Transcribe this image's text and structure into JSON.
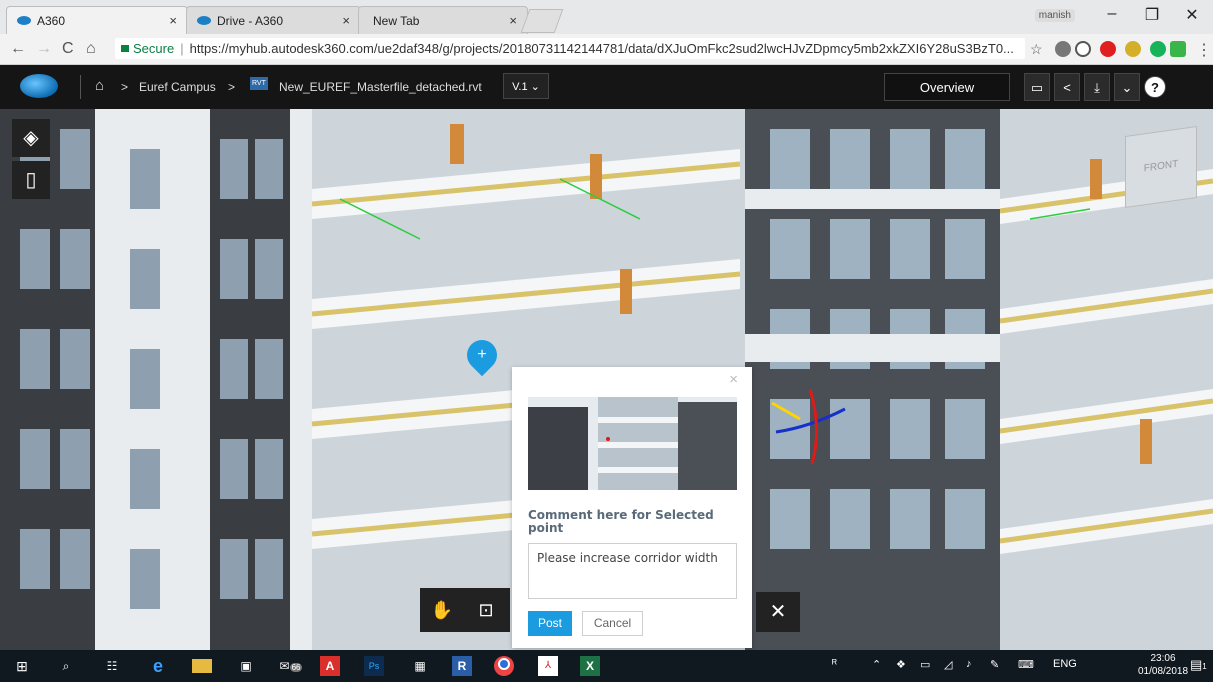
{
  "browser": {
    "tabs": [
      {
        "title": "A360",
        "close": "×"
      },
      {
        "title": "Drive - A360",
        "close": "×"
      },
      {
        "title": "New Tab",
        "close": "×"
      }
    ],
    "profile_user": "manish",
    "window_controls": {
      "minimize": "–",
      "maximize": "❐",
      "close": "✕"
    },
    "nav": {
      "back": "←",
      "forward": "→",
      "reload": "C",
      "home": "⌂"
    },
    "secure_label": "Secure",
    "url": "https://myhub.autodesk360.com/ue2daf348/g/projects/20180731142144781/data/dXJuOmFkc2sud2lwcHJvZDpmcy5mb2xkZXI6Y28uS3BzT0...",
    "star_icon": "☆"
  },
  "app": {
    "breadcrumb": {
      "home_icon": "home-icon",
      "sep1": ">",
      "project": "Euref Campus",
      "sep2": ">",
      "file_badge": "RVT",
      "file": "New_EUREF_Masterfile_detached.rvt"
    },
    "version": "V.1 ⌄",
    "overview": "Overview",
    "header_buttons": {
      "comment": "▭",
      "share": "<",
      "download": "⤓",
      "more": "⌄",
      "help": "?"
    }
  },
  "viewer": {
    "tools": {
      "cube_icon": "◈",
      "sheet_icon": "▯"
    },
    "viewcube_label": "FRONT",
    "pin_icon": "+",
    "bottom_tools": {
      "pan": "✋",
      "zoom_region": "⊡"
    },
    "close": "✕"
  },
  "comment_popup": {
    "close": "×",
    "title": "Comment here for Selected point",
    "text": "Please increase corridor width",
    "post": "Post",
    "cancel": "Cancel"
  },
  "taskbar": {
    "lang": "ENG",
    "time": "23:06",
    "date": "01/08/2018",
    "mail_badge": "66",
    "notif_badge": "1"
  }
}
